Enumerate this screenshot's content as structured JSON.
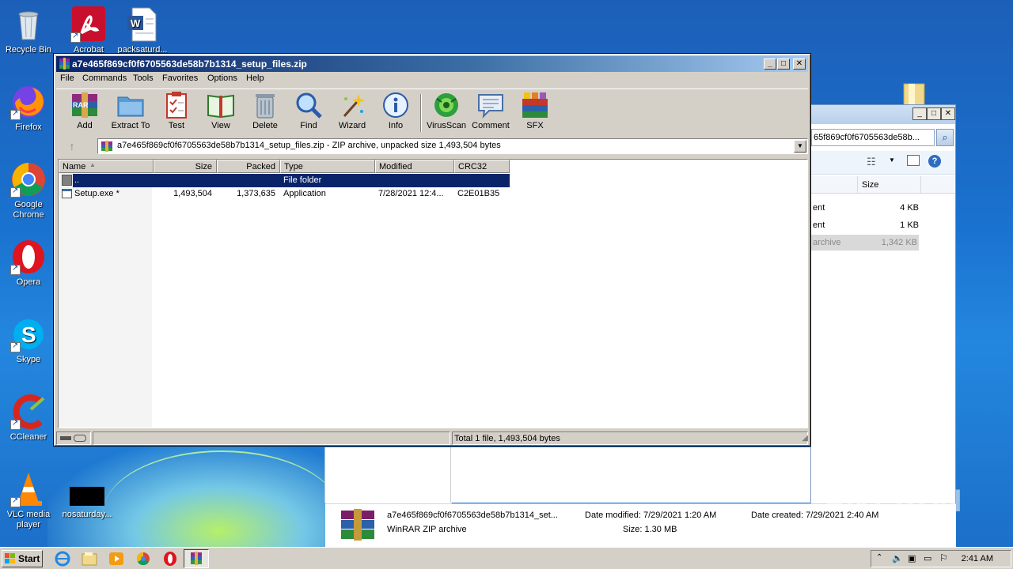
{
  "desktop": {
    "icons": [
      {
        "label": "Recycle Bin"
      },
      {
        "label": "Acrobat"
      },
      {
        "label": "packsaturd..."
      },
      {
        "label": "Firefox"
      },
      {
        "label": "Google Chrome"
      },
      {
        "label": "Opera"
      },
      {
        "label": "Skype"
      },
      {
        "label": "CCleaner"
      },
      {
        "label": "VLC media player"
      },
      {
        "label": "nosaturday..."
      }
    ]
  },
  "explorer": {
    "address": "65f869cf0f6705563de58b...",
    "col_size": "Size",
    "rows": [
      {
        "type": "ent",
        "size": "4 KB"
      },
      {
        "type": "ent",
        "size": "1 KB"
      },
      {
        "type": "archive",
        "size": "1,342 KB"
      }
    ],
    "details": {
      "name": "a7e465f869cf0f6705563de58b7b1314_set...",
      "type": "WinRAR ZIP archive",
      "modified": "Date modified: 7/29/2021 1:20 AM",
      "size": "Size: 1.30 MB",
      "created": "Date created: 7/29/2021 2:40 AM"
    }
  },
  "winrar": {
    "title": "a7e465f869cf0f6705563de58b7b1314_setup_files.zip",
    "menu": [
      "File",
      "Commands",
      "Tools",
      "Favorites",
      "Options",
      "Help"
    ],
    "toolbar": [
      "Add",
      "Extract To",
      "Test",
      "View",
      "Delete",
      "Find",
      "Wizard",
      "Info",
      "VirusScan",
      "Comment",
      "SFX"
    ],
    "path": "a7e465f869cf0f6705563de58b7b1314_setup_files.zip - ZIP archive, unpacked size 1,493,504 bytes",
    "columns": [
      "Name",
      "Size",
      "Packed",
      "Type",
      "Modified",
      "CRC32"
    ],
    "files": [
      {
        "name": "..",
        "size": "",
        "packed": "",
        "type": "File folder",
        "modified": "",
        "crc": ""
      },
      {
        "name": "Setup.exe *",
        "size": "1,493,504",
        "packed": "1,373,635",
        "type": "Application",
        "modified": "7/28/2021 12:4...",
        "crc": "C2E01B35"
      }
    ],
    "status": "Total 1 file, 1,493,504 bytes"
  },
  "taskbar": {
    "start": "Start",
    "clock": "2:41 AM"
  },
  "watermark": "ANY RUN",
  "colors": {
    "title_active": "#0a246a",
    "selection": "#0a246a",
    "desktop": "#1a72cf"
  }
}
